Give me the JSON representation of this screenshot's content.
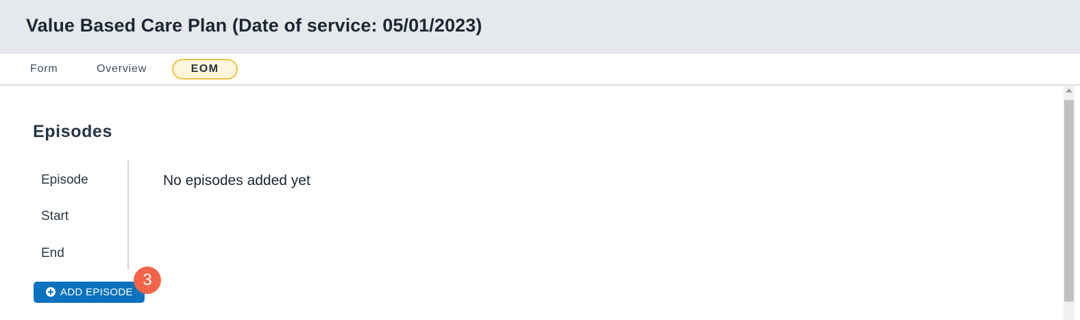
{
  "header": {
    "title": "Value Based Care Plan (Date of service: 05/01/2023)"
  },
  "tabs": [
    {
      "label": "Form",
      "active": false
    },
    {
      "label": "Overview",
      "active": false
    },
    {
      "label": "EOM",
      "active": true
    }
  ],
  "episodes": {
    "title": "Episodes",
    "field_labels": [
      "Episode",
      "Start",
      "End"
    ],
    "empty_message": "No episodes added yet",
    "add_button_label": "ADD EPISODE",
    "add_button_icon": "plus-circle-icon",
    "badge_count": "3"
  },
  "colors": {
    "header_bg": "#e6e9ec",
    "active_tab_border": "#f0c33c",
    "active_tab_bg": "#fdf5dc",
    "button_bg": "#0b72bd",
    "badge_bg": "#f2644a"
  }
}
